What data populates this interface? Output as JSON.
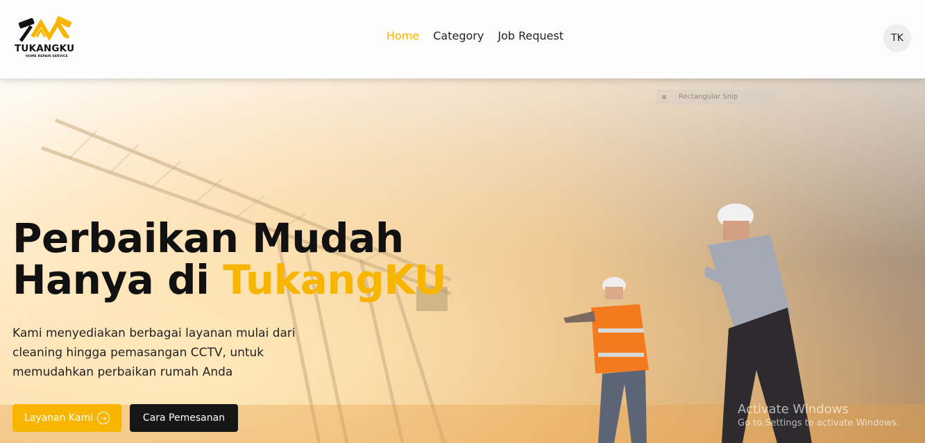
{
  "brand": {
    "name": "TUKANGKU",
    "tagline": "HOME REPAIR SERVICE"
  },
  "nav": {
    "links": [
      "Home",
      "Category",
      "Job Request"
    ],
    "active": "Home"
  },
  "user": {
    "initials": "TK"
  },
  "hero": {
    "title_line1": "Perbaikan Mudah",
    "title_line2_prefix": "Hanya di ",
    "title_line2_accent": "TukangKU",
    "description": "Kami menyediakan berbagai layanan mulai dari cleaning hingga pemasangan CCTV, untuk memudahkan perbaikan rumah Anda",
    "primary_button": "Layanan Kami",
    "secondary_button": "Cara Pemesanan"
  },
  "overlay": {
    "snip_label": "Rectangular Snip",
    "activate_title": "Activate Windows",
    "activate_sub": "Go to Settings to activate Windows."
  },
  "colors": {
    "accent": "#f7b500",
    "dark_button": "#161616",
    "text": "#111111"
  },
  "icons": {
    "primary_button_icon": "arrow-right-circle-icon",
    "logo": "crossed-hammers-roof-icon"
  }
}
